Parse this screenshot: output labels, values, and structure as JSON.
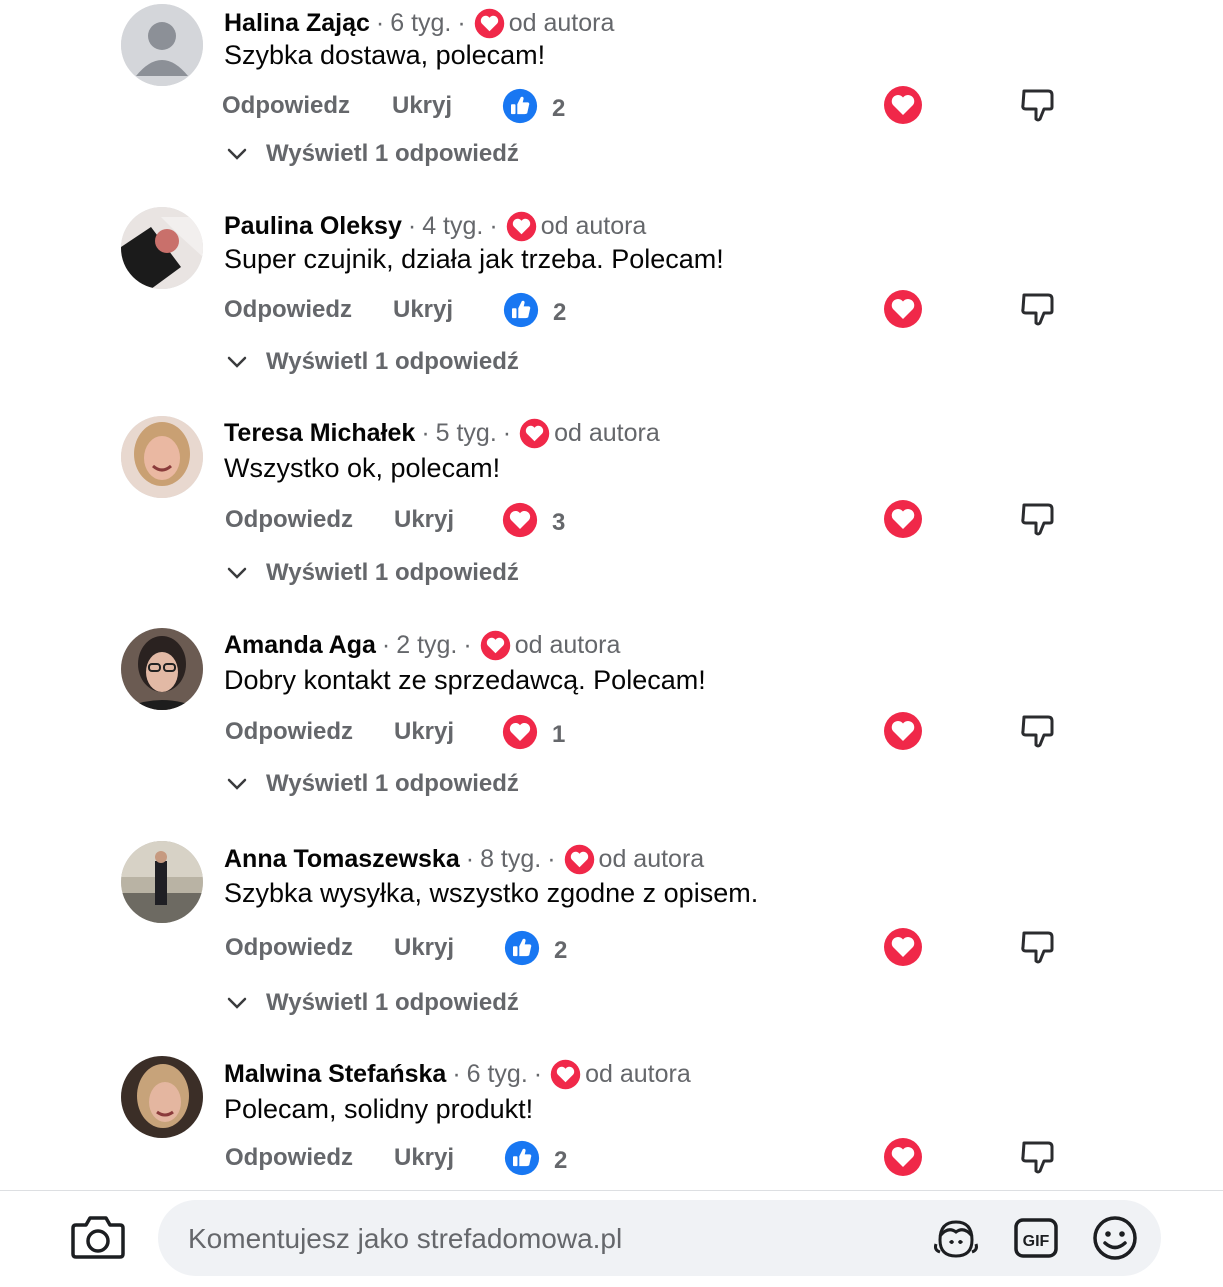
{
  "comments": [
    {
      "name": "Halina Zając",
      "time": "6 tyg.",
      "author_label": "od autora",
      "text": "Szybka dostawa, polecam!",
      "reply": "Odpowiedz",
      "hide": "Ukryj",
      "reaction": "like",
      "count": "2",
      "view_replies": "Wyświetl 1 odpowiedź",
      "avatar": "default"
    },
    {
      "name": "Paulina Oleksy",
      "time": "4 tyg.",
      "author_label": "od autora",
      "text": "Super czujnik, działa jak trzeba. Polecam!",
      "reply": "Odpowiedz",
      "hide": "Ukryj",
      "reaction": "like",
      "count": "2",
      "view_replies": "Wyświetl 1 odpowiedź",
      "avatar": "photo"
    },
    {
      "name": "Teresa Michałek",
      "time": "5 tyg.",
      "author_label": "od autora",
      "text": "Wszystko ok, polecam!",
      "reply": "Odpowiedz",
      "hide": "Ukryj",
      "reaction": "love",
      "count": "3",
      "view_replies": "Wyświetl 1 odpowiedź",
      "avatar": "photo"
    },
    {
      "name": "Amanda Aga",
      "time": "2 tyg.",
      "author_label": "od autora",
      "text": "Dobry kontakt ze sprzedawcą. Polecam!",
      "reply": "Odpowiedz",
      "hide": "Ukryj",
      "reaction": "love",
      "count": "1",
      "view_replies": "Wyświetl 1 odpowiedź",
      "avatar": "photo"
    },
    {
      "name": "Anna Tomaszewska",
      "time": "8 tyg.",
      "author_label": "od autora",
      "text": "Szybka wysyłka, wszystko zgodne z opisem.",
      "reply": "Odpowiedz",
      "hide": "Ukryj",
      "reaction": "like",
      "count": "2",
      "view_replies": "Wyświetl 1 odpowiedź",
      "avatar": "photo"
    },
    {
      "name": "Malwina Stefańska",
      "time": "6 tyg.",
      "author_label": "od autora",
      "text": "Polecam, solidny produkt!",
      "reply": "Odpowiedz",
      "hide": "Ukryj",
      "reaction": "like",
      "count": "2",
      "view_replies": "",
      "avatar": "photo"
    }
  ],
  "composer": {
    "placeholder": "Komentujesz jako strefadomowa.pl",
    "gif_label": "GIF"
  },
  "colors": {
    "like": "#1877f2",
    "love": "#f02849",
    "muted": "#65676b",
    "input_bg": "#f0f2f5"
  },
  "icons": [
    "camera-icon",
    "avatar-sticker-icon",
    "gif-icon",
    "emoji-icon",
    "heart-icon",
    "dislike-icon",
    "chevron-down-icon",
    "like-icon"
  ]
}
